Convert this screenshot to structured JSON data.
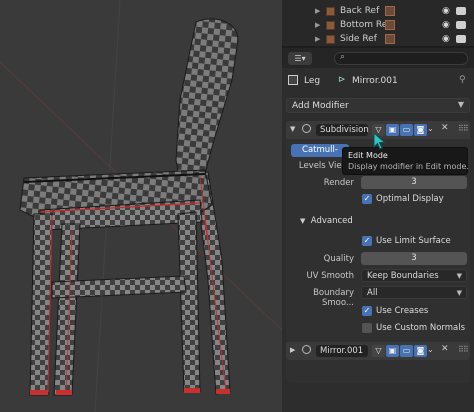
{
  "outliner": {
    "items": [
      {
        "label": "Back Ref"
      },
      {
        "label": "Bottom Ref"
      },
      {
        "label": "Side Ref"
      }
    ]
  },
  "properties": {
    "editor_type_icon": "properties-editor-icon",
    "search": {
      "placeholder": "",
      "value": ""
    },
    "context": {
      "object": "Leg",
      "modifier": "Mirror.001"
    },
    "add_modifier_label": "Add Modifier",
    "subdivision": {
      "name": "Subdivision",
      "catmull_label": "Catmull-",
      "levels_viewport_label": "Levels Viewp",
      "render_label": "Render",
      "render_value": "3",
      "optimal_display_label": "Optimal Display",
      "optimal_display_checked": true,
      "advanced_label": "Advanced",
      "use_limit_surface_label": "Use Limit Surface",
      "use_limit_surface_checked": true,
      "quality_label": "Quality",
      "quality_value": "3",
      "uv_smooth_label": "UV Smooth",
      "uv_smooth_value": "Keep Boundaries",
      "boundary_smooth_label": "Boundary Smoo...",
      "boundary_smooth_value": "All",
      "use_creases_label": "Use Creases",
      "use_creases_checked": true,
      "use_custom_normals_label": "Use Custom Normals",
      "use_custom_normals_checked": false
    },
    "mirror": {
      "name": "Mirror.001"
    }
  },
  "tooltip": {
    "title": "Edit Mode",
    "description": "Display modifier in Edit mode."
  },
  "colors": {
    "accent": "#4772b3",
    "cursor": "#2ec4c4"
  }
}
